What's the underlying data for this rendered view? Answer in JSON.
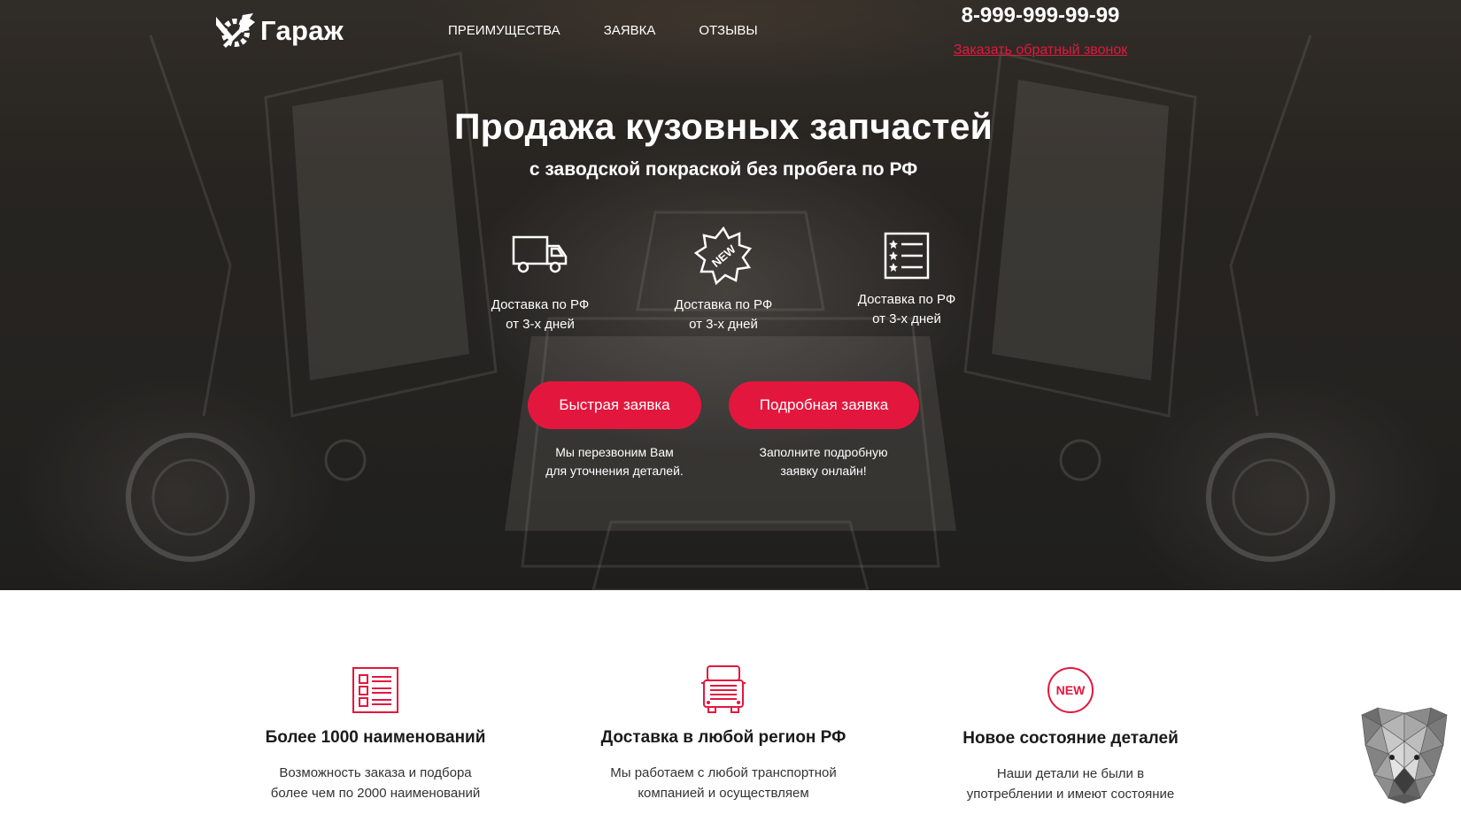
{
  "brand": {
    "name": "Гараж"
  },
  "nav": [
    {
      "label": "Преимущества"
    },
    {
      "label": "Заявка"
    },
    {
      "label": "Отзывы"
    }
  ],
  "contact": {
    "phone": "8-999-999-99-99",
    "callback_label": "Заказать обратный звонок"
  },
  "hero": {
    "title": "Продажа кузовных запчастей",
    "subtitle": "с заводской покраской без пробега по РФ",
    "features": [
      {
        "icon": "truck-icon",
        "line1": "Доставка по РФ",
        "line2": "от 3-х дней"
      },
      {
        "icon": "new-badge-icon",
        "line1": "Доставка по РФ",
        "line2": "от 3-х дней"
      },
      {
        "icon": "checklist-icon",
        "line1": "Доставка по РФ",
        "line2": "от 3-х дней"
      }
    ],
    "buttons": [
      {
        "label": "Быстрая заявка",
        "note1": "Мы перезвоним Вам",
        "note2": "для уточнения деталей."
      },
      {
        "label": "Подробная заявка",
        "note1": "Заполните подробную",
        "note2": "заявку онлайн!"
      }
    ]
  },
  "benefits": [
    {
      "icon": "list-icon",
      "title": "Более 1000 наименований",
      "line1": "Возможность заказа и подбора",
      "line2": "более чем по 2000 наименований"
    },
    {
      "icon": "truck-front-icon",
      "title": "Доставка в любой регион РФ",
      "line1": "Мы работаем с любой транспортной",
      "line2": "компанией и осуществляем"
    },
    {
      "icon": "new-circle-icon",
      "title": "Новое состояние деталей",
      "line1": "Наши детали не были в",
      "line2": "употреблении и имеют состояние"
    }
  ],
  "colors": {
    "accent": "#e3173e",
    "hero_dark": "#2b2927",
    "text": "#ffffff"
  },
  "widget": {
    "icon": "bear-icon"
  }
}
